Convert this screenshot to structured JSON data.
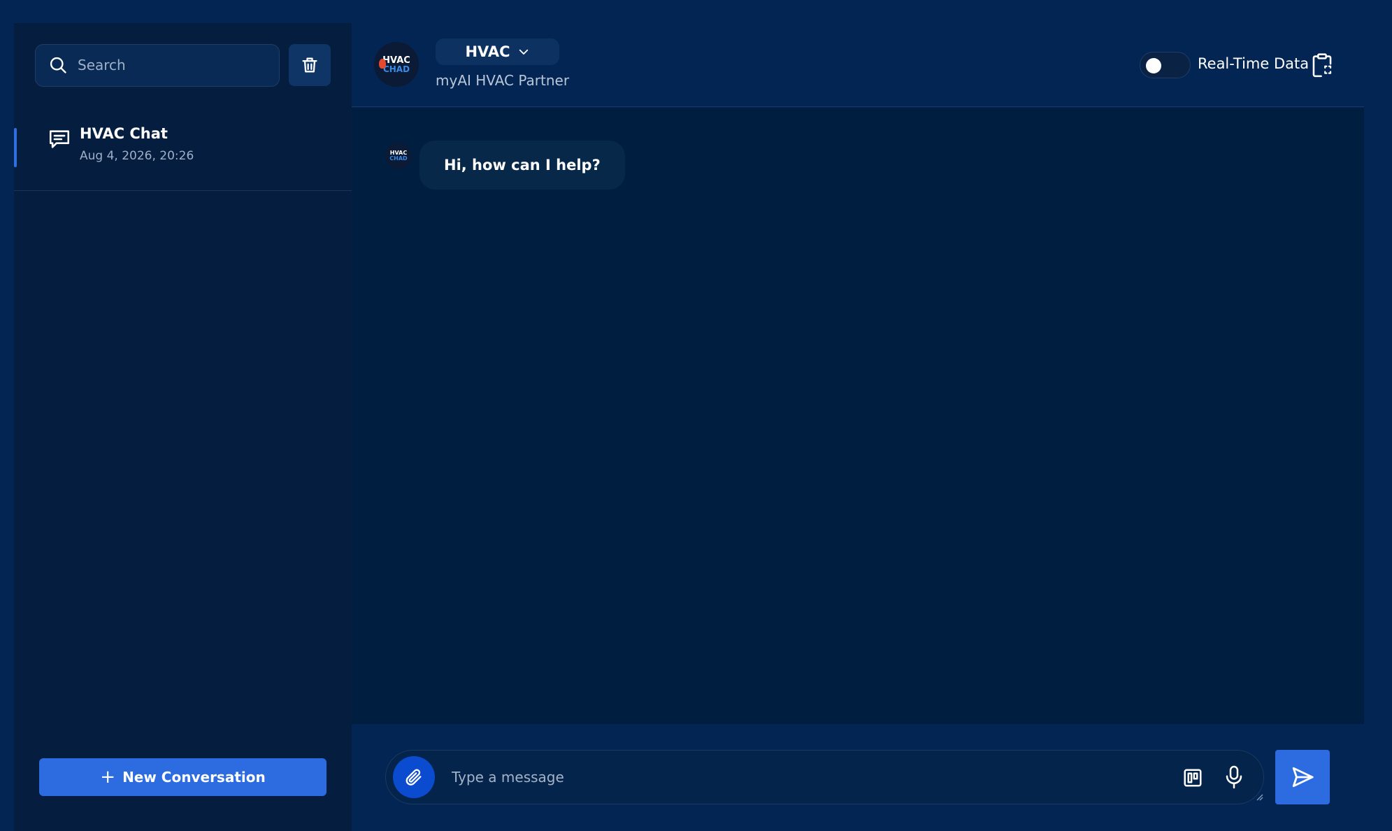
{
  "sidebar": {
    "search": {
      "placeholder": "Search"
    },
    "conversations": [
      {
        "title": "HVAC Chat",
        "date": "Aug 4, 2026, 20:26"
      }
    ],
    "new_conversation_label": "New Conversation"
  },
  "header": {
    "logo": {
      "line1": "HVAC",
      "line2": "CHAD"
    },
    "model_selected": "HVAC",
    "subtitle": "myAI HVAC Partner",
    "realtime_toggle": {
      "label": "Real-Time Data",
      "on": false
    }
  },
  "chat": {
    "messages": [
      {
        "role": "assistant",
        "text": "Hi, how can I help?"
      }
    ]
  },
  "composer": {
    "placeholder": "Type a message"
  },
  "colors": {
    "accent": "#2d6be0",
    "sidebar_bg": "#051e40",
    "chat_bg": "#001e3f",
    "page_bg": "#032553"
  },
  "icons": [
    "search-icon",
    "trash-icon",
    "chat-bubble-icon",
    "chevron-down-icon",
    "clipboard-icon",
    "paperclip-icon",
    "board-icon",
    "microphone-icon",
    "send-icon",
    "plus-icon"
  ]
}
